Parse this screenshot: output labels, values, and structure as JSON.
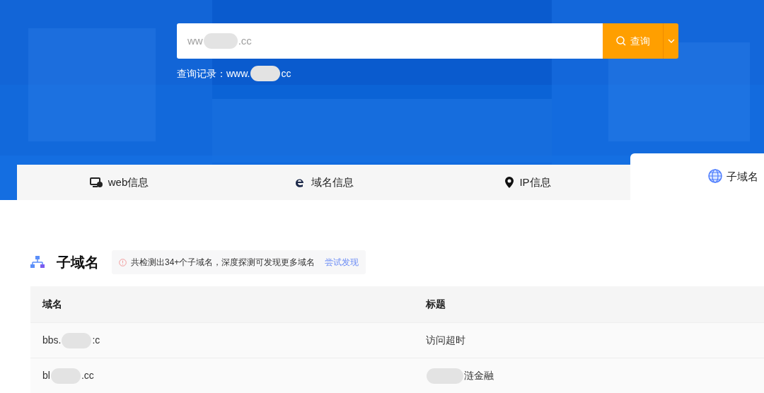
{
  "search": {
    "value_start": "ww",
    "value_end": ".cc",
    "button": "查询"
  },
  "history": {
    "label": "查询记录：",
    "value_start": "www.",
    "value_end": "cc"
  },
  "tabs": [
    {
      "label": "web信息",
      "kind": "monitor",
      "selected": false
    },
    {
      "label": "域名信息",
      "kind": "ie",
      "selected": false
    },
    {
      "label": "IP信息",
      "kind": "pin",
      "selected": false
    },
    {
      "label": "子域名",
      "kind": "globe",
      "selected": true
    }
  ],
  "section": {
    "title": "子域名",
    "notice": "共检测出34+个子域名，深度探测可发现更多域名",
    "link": "尝试发现"
  },
  "table": {
    "columns": [
      "域名",
      "标题"
    ],
    "rows": [
      {
        "domain_start": "bbs.",
        "domain_end": ":c",
        "title_end": "访问超时",
        "title_blurred": false
      },
      {
        "domain_start": "bl",
        "domain_end": ".cc",
        "title_end": "涟金融",
        "title_blurred": true
      }
    ]
  }
}
